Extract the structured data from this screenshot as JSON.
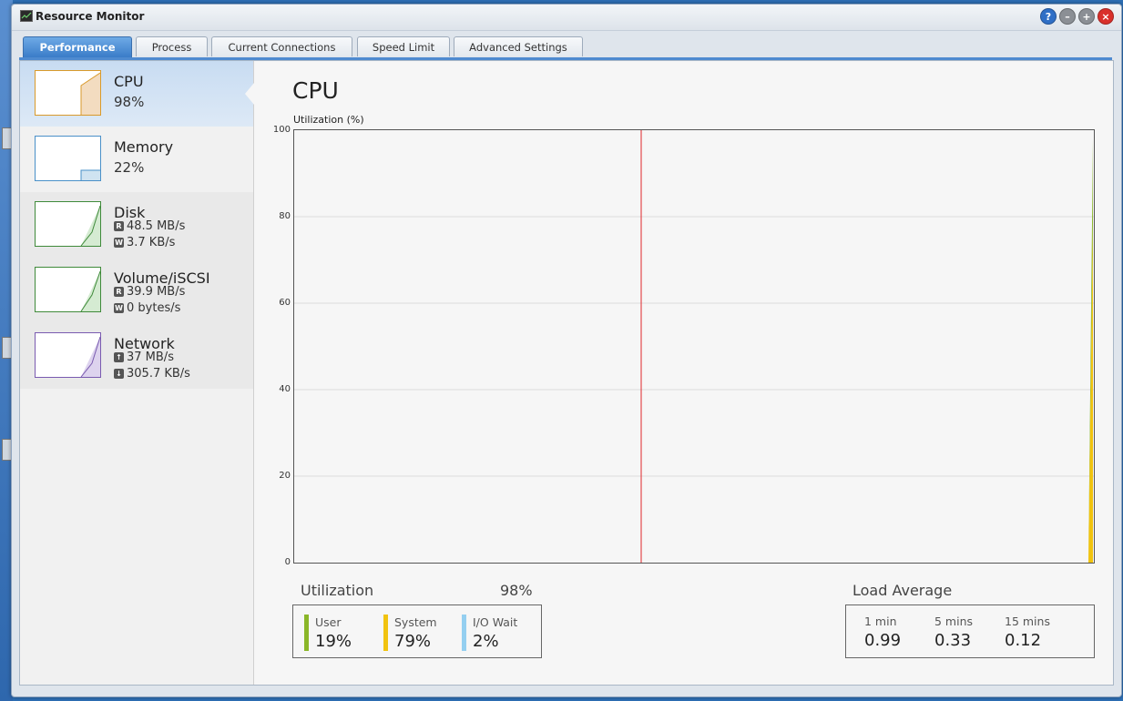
{
  "window": {
    "title": "Resource Monitor"
  },
  "tabs": [
    {
      "label": "Performance",
      "active": true
    },
    {
      "label": "Process",
      "active": false
    },
    {
      "label": "Current Connections",
      "active": false
    },
    {
      "label": "Speed Limit",
      "active": false
    },
    {
      "label": "Advanced Settings",
      "active": false
    }
  ],
  "sidebar": {
    "cpu": {
      "name": "CPU",
      "value": "98%",
      "color": "#d99a2b"
    },
    "memory": {
      "name": "Memory",
      "value": "22%",
      "color": "#4a90c8"
    },
    "disk": {
      "name": "Disk",
      "read_badge": "R",
      "read": "48.5 MB/s",
      "write_badge": "W",
      "write": "3.7 KB/s",
      "color": "#3f8a3a"
    },
    "volume": {
      "name": "Volume/iSCSI",
      "read_badge": "R",
      "read": "39.9 MB/s",
      "write_badge": "W",
      "write": "0 bytes/s",
      "color": "#3f8a3a"
    },
    "network": {
      "name": "Network",
      "up": "37 MB/s",
      "down": "305.7 KB/s",
      "color": "#7a5bb0"
    }
  },
  "main": {
    "title": "CPU",
    "axis_label": "Utilization (%)",
    "utilization_label": "Utilization",
    "utilization_value": "98%",
    "stats": [
      {
        "label": "User",
        "value": "19%",
        "color": "#8ab628"
      },
      {
        "label": "System",
        "value": "79%",
        "color": "#f1c30f"
      },
      {
        "label": "I/O Wait",
        "value": "2%",
        "color": "#94cff0"
      }
    ],
    "load_average": {
      "label": "Load Average",
      "items": [
        {
          "label": "1 min",
          "value": "0.99"
        },
        {
          "label": "5 mins",
          "value": "0.33"
        },
        {
          "label": "15 mins",
          "value": "0.12"
        }
      ]
    }
  },
  "chart_data": {
    "type": "area",
    "ylabel": "Utilization (%)",
    "ylim": [
      0,
      100
    ],
    "yticks": [
      "100",
      "80",
      "60",
      "40",
      "20",
      "0"
    ],
    "grid": true,
    "series": [
      {
        "name": "User",
        "color": "#8ab628",
        "values": [
          0,
          0,
          19
        ]
      },
      {
        "name": "System",
        "color": "#f1c30f",
        "values": [
          0,
          0,
          79
        ]
      }
    ],
    "marker_line_color": "#e0262b"
  }
}
